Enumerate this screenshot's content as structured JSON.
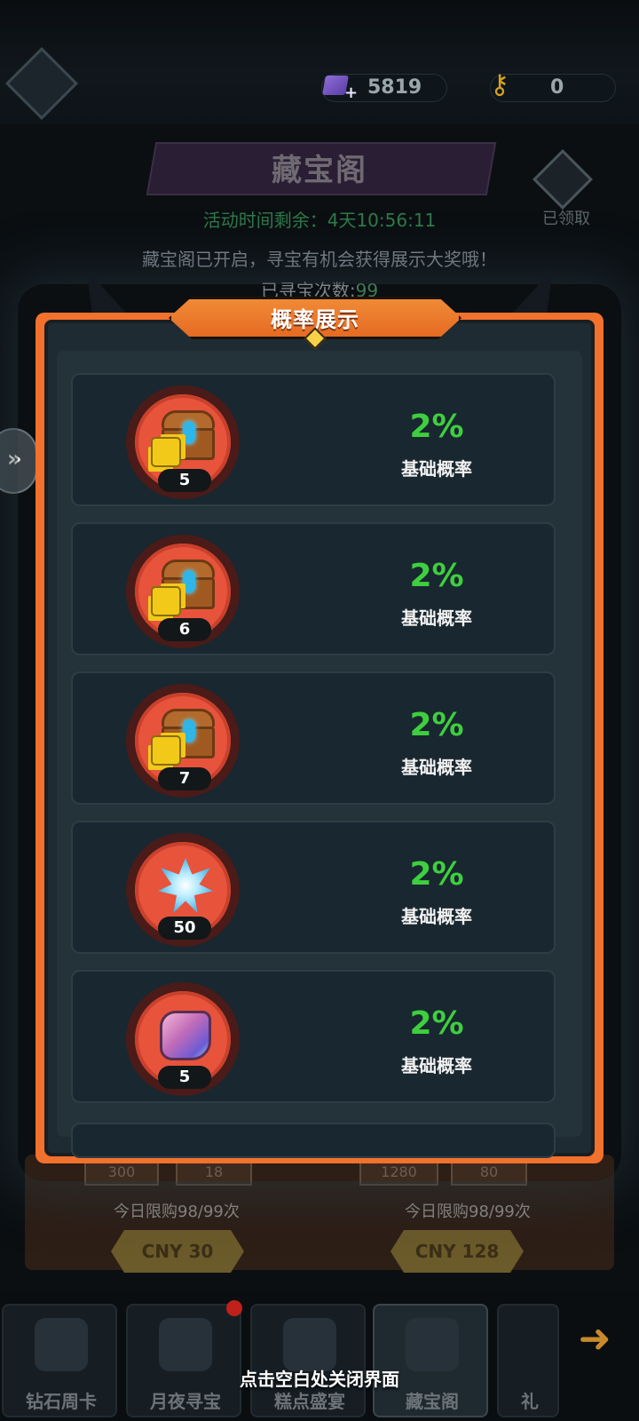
{
  "currency": {
    "gems": "5819",
    "keys": "0"
  },
  "background": {
    "title": "藏宝阁",
    "timer": "活动时间剩余：4天10:56:11",
    "open_message": "藏宝阁已开启，寻宝有机会获得展示大奖哦！",
    "count_label": "已寻宝次数:",
    "count_value": "99",
    "claimed_label": "已领取",
    "limit_left": "今日限购98/99次",
    "limit_right": "今日限购98/99次",
    "price_left": "CNY 30",
    "price_right": "CNY 128",
    "mini_values": [
      "300",
      "18",
      "1280",
      "80"
    ]
  },
  "modal": {
    "title": "概率展示",
    "rows": [
      {
        "icon": "treasure-chest-puzzle-icon",
        "count": "5",
        "percent": "2%",
        "label": "基础概率"
      },
      {
        "icon": "treasure-chest-puzzle-icon",
        "count": "6",
        "percent": "2%",
        "label": "基础概率"
      },
      {
        "icon": "treasure-chest-puzzle-icon",
        "count": "7",
        "percent": "2%",
        "label": "基础概率"
      },
      {
        "icon": "blue-crystal-icon",
        "count": "50",
        "percent": "2%",
        "label": "基础概率"
      },
      {
        "icon": "pink-ore-icon",
        "count": "5",
        "percent": "2%",
        "label": "基础概率"
      }
    ]
  },
  "nav": {
    "tabs": [
      "钻石周卡",
      "月夜寻宝",
      "糕点盛宴",
      "藏宝阁",
      "礼"
    ]
  },
  "close_hint": "点击空白处关闭界面",
  "colors": {
    "accent_orange": "#f2712d",
    "percent_green": "#3ecf3e"
  }
}
